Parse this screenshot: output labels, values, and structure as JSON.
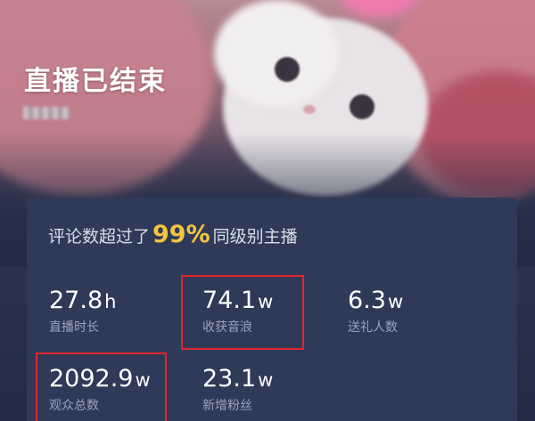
{
  "header": {
    "title": "直播已结束"
  },
  "summary": {
    "prefix": "评论数超过了",
    "percent": "99%",
    "suffix": "同级别主播"
  },
  "stats": [
    {
      "value": "27.8",
      "unit": "h",
      "label": "直播时长"
    },
    {
      "value": "74.1",
      "unit": "w",
      "label": "收获音浪"
    },
    {
      "value": "6.3",
      "unit": "w",
      "label": "送礼人数"
    },
    {
      "value": "2092.9",
      "unit": "w",
      "label": "观众总数"
    },
    {
      "value": "23.1",
      "unit": "w",
      "label": "新增粉丝"
    }
  ],
  "colors": {
    "accent_percent": "#f5c541",
    "highlight_box": "#e0252d",
    "card_bg": "#2f3a58"
  }
}
